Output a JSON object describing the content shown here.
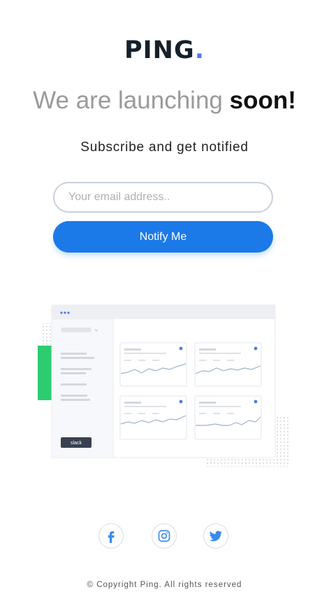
{
  "brand": {
    "name": "PING",
    "dot": ".",
    "accent_color": "#4c7be8"
  },
  "hero": {
    "headline_light": "We are launching",
    "headline_bold": "soon!"
  },
  "subscribe": {
    "subtitle": "Subscribe and get notified",
    "email_placeholder": "Your email address..",
    "button_label": "Notify Me",
    "button_color": "#1b7ae8"
  },
  "illustration": {
    "badge_label": "slack"
  },
  "social": [
    {
      "name": "facebook",
      "icon": "facebook-icon"
    },
    {
      "name": "instagram",
      "icon": "instagram-icon"
    },
    {
      "name": "twitter",
      "icon": "twitter-icon"
    }
  ],
  "footer": {
    "copyright": "© Copyright Ping. All rights reserved"
  }
}
